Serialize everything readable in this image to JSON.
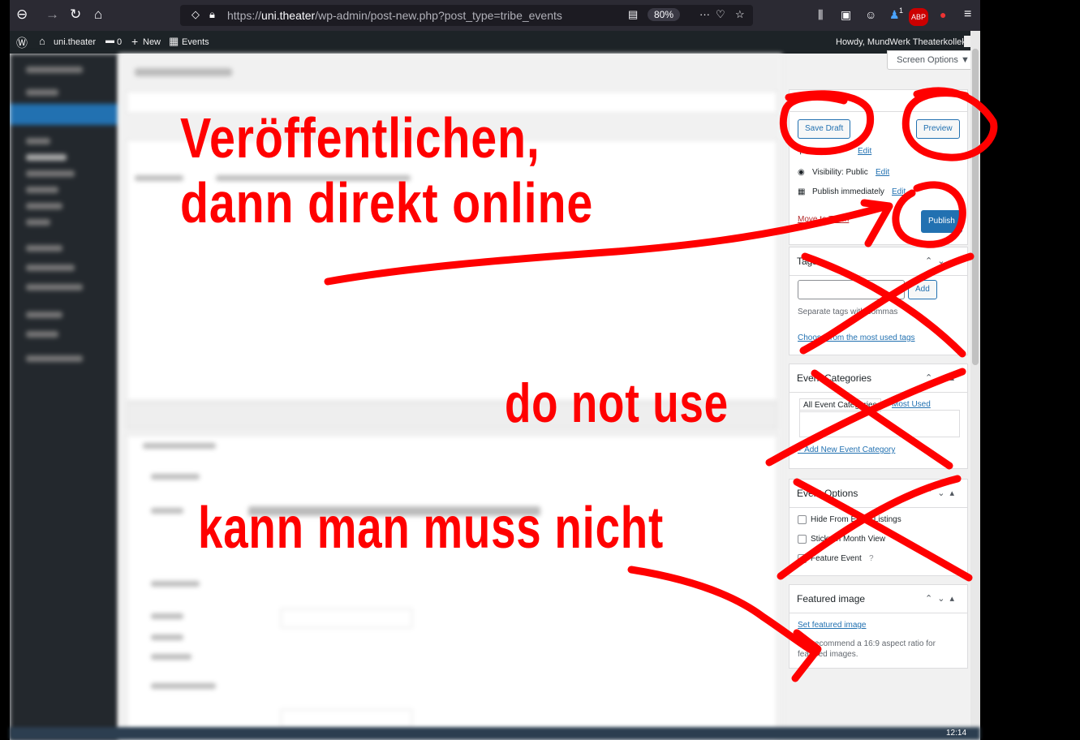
{
  "browser": {
    "url_prefix": "https://",
    "url_domain": "uni.theater",
    "url_path": "/wp-admin/post-new.php?post_type=tribe_events",
    "zoom": "80%",
    "abp_badge": "ABP",
    "notif_count": "1"
  },
  "admin_bar": {
    "site": "uni.theater",
    "comments": "0",
    "new": "New",
    "events": "Events",
    "howdy": "Howdy, MundWerk Theaterkollektiv"
  },
  "screen_options": "Screen Options ▼",
  "publish_box": {
    "save_draft": "Save Draft",
    "preview": "Preview",
    "edit1": "Edit",
    "visibility": "Visibility: Public",
    "edit2": "Edit",
    "publish_when": "Publish immediately",
    "edit3": "Edit",
    "move_to_trash": "Move to Trash",
    "publish": "Publish"
  },
  "tags_box": {
    "title": "Tags",
    "add": "Add",
    "hint": "Separate tags with commas",
    "choose": "Choose from the most used tags"
  },
  "categories_box": {
    "title": "Event Categories",
    "tab_all": "All Event Categories",
    "tab_used": "Most Used",
    "add_new": "+ Add New Event Category"
  },
  "options_box": {
    "title": "Event Options",
    "hide": "Hide From Event Listings",
    "sticky": "Sticky in Month View",
    "feature": "Feature Event"
  },
  "featured_box": {
    "title": "Featured image",
    "set": "Set featured image",
    "note": "We recommend a 16:9 aspect ratio for featured images."
  },
  "taskbar": {
    "clock": "12:14"
  },
  "annotations": {
    "line1": "Veröffentlichen,",
    "line2": "dann direkt online",
    "do_not_use": "do not use",
    "kann": "kann man muss nicht"
  },
  "colors": {
    "annotation": "#ff0000",
    "wp_blue": "#2271b1"
  }
}
